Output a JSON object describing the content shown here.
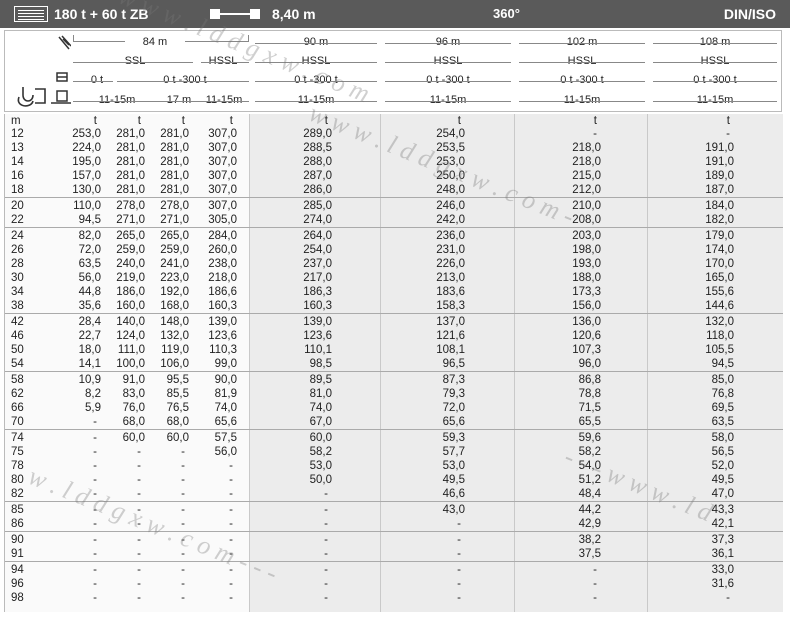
{
  "topbar": {
    "configuration": "180 t + 60 t ZB",
    "counterweight_radius": "8,40 m",
    "slew": "360°",
    "standard": "DIN/ISO"
  },
  "header": {
    "columns": [
      {
        "length": "84 m",
        "mode_a": "SSL",
        "mode_b": "HSSL",
        "ballast_a": "0 t",
        "ballast_b": "0 t -300 t",
        "angle_a": "11-15m",
        "angle_b": "17 m",
        "angle_c": "11-15m"
      },
      {
        "length": "90 m",
        "mode": "HSSL",
        "ballast": "0 t -300 t",
        "angle": "11-15m"
      },
      {
        "length": "96 m",
        "mode": "HSSL",
        "ballast": "0 t -300 t",
        "angle": "11-15m"
      },
      {
        "length": "102 m",
        "mode": "HSSL",
        "ballast": "0 t -300 t",
        "angle": "11-15m"
      },
      {
        "length": "108 m",
        "mode": "HSSL",
        "ballast": "0 t -300 t",
        "angle": "11-15m"
      }
    ]
  },
  "units": {
    "radius": "m",
    "load": "t"
  },
  "rows": [
    [
      "12",
      "253,0",
      "281,0",
      "281,0",
      "307,0",
      "289,0",
      "254,0",
      "-",
      "-"
    ],
    [
      "13",
      "224,0",
      "281,0",
      "281,0",
      "307,0",
      "288,5",
      "253,5",
      "218,0",
      "191,0"
    ],
    [
      "14",
      "195,0",
      "281,0",
      "281,0",
      "307,0",
      "288,0",
      "253,0",
      "218,0",
      "191,0"
    ],
    [
      "16",
      "157,0",
      "281,0",
      "281,0",
      "307,0",
      "287,0",
      "250,0",
      "215,0",
      "189,0"
    ],
    [
      "18",
      "130,0",
      "281,0",
      "281,0",
      "307,0",
      "286,0",
      "248,0",
      "212,0",
      "187,0"
    ],
    [
      "20",
      "110,0",
      "278,0",
      "278,0",
      "307,0",
      "285,0",
      "246,0",
      "210,0",
      "184,0"
    ],
    [
      "22",
      "94,5",
      "271,0",
      "271,0",
      "305,0",
      "274,0",
      "242,0",
      "208,0",
      "182,0"
    ],
    [
      "24",
      "82,0",
      "265,0",
      "265,0",
      "284,0",
      "264,0",
      "236,0",
      "203,0",
      "179,0"
    ],
    [
      "26",
      "72,0",
      "259,0",
      "259,0",
      "260,0",
      "254,0",
      "231,0",
      "198,0",
      "174,0"
    ],
    [
      "28",
      "63,5",
      "240,0",
      "241,0",
      "238,0",
      "237,0",
      "226,0",
      "193,0",
      "170,0"
    ],
    [
      "30",
      "56,0",
      "219,0",
      "223,0",
      "218,0",
      "217,0",
      "213,0",
      "188,0",
      "165,0"
    ],
    [
      "34",
      "44,8",
      "186,0",
      "192,0",
      "186,6",
      "186,3",
      "183,6",
      "173,3",
      "155,6"
    ],
    [
      "38",
      "35,6",
      "160,0",
      "168,0",
      "160,3",
      "160,3",
      "158,3",
      "156,0",
      "144,6"
    ],
    [
      "42",
      "28,4",
      "140,0",
      "148,0",
      "139,0",
      "139,0",
      "137,0",
      "136,0",
      "132,0"
    ],
    [
      "46",
      "22,7",
      "124,0",
      "132,0",
      "123,6",
      "123,6",
      "121,6",
      "120,6",
      "118,0"
    ],
    [
      "50",
      "18,0",
      "111,0",
      "119,0",
      "110,3",
      "110,1",
      "108,1",
      "107,3",
      "105,5"
    ],
    [
      "54",
      "14,1",
      "100,0",
      "106,0",
      "99,0",
      "98,5",
      "96,5",
      "96,0",
      "94,5"
    ],
    [
      "58",
      "10,9",
      "91,0",
      "95,5",
      "90,0",
      "89,5",
      "87,3",
      "86,8",
      "85,0"
    ],
    [
      "62",
      "8,2",
      "83,0",
      "85,5",
      "81,9",
      "81,0",
      "79,3",
      "78,8",
      "76,8"
    ],
    [
      "66",
      "5,9",
      "76,0",
      "76,5",
      "74,0",
      "74,0",
      "72,0",
      "71,5",
      "69,5"
    ],
    [
      "70",
      "-",
      "68,0",
      "68,0",
      "65,6",
      "67,0",
      "65,6",
      "65,5",
      "63,5"
    ],
    [
      "74",
      "-",
      "60,0",
      "60,0",
      "57,5",
      "60,0",
      "59,3",
      "59,6",
      "58,0"
    ],
    [
      "75",
      "-",
      "-",
      "-",
      "56,0",
      "58,2",
      "57,7",
      "58,2",
      "56,5"
    ],
    [
      "78",
      "-",
      "-",
      "-",
      "-",
      "53,0",
      "53,0",
      "54,0",
      "52,0"
    ],
    [
      "80",
      "-",
      "-",
      "-",
      "-",
      "50,0",
      "49,5",
      "51,2",
      "49,5"
    ],
    [
      "82",
      "-",
      "-",
      "-",
      "-",
      "-",
      "46,6",
      "48,4",
      "47,0"
    ],
    [
      "85",
      "-",
      "-",
      "-",
      "-",
      "-",
      "43,0",
      "44,2",
      "43,3"
    ],
    [
      "86",
      "-",
      "-",
      "-",
      "-",
      "-",
      "-",
      "42,9",
      "42,1"
    ],
    [
      "90",
      "-",
      "-",
      "-",
      "-",
      "-",
      "-",
      "38,2",
      "37,3"
    ],
    [
      "91",
      "-",
      "-",
      "-",
      "-",
      "-",
      "-",
      "37,5",
      "36,1"
    ],
    [
      "94",
      "-",
      "-",
      "-",
      "-",
      "-",
      "-",
      "-",
      "33,0"
    ],
    [
      "96",
      "-",
      "-",
      "-",
      "-",
      "-",
      "-",
      "-",
      "31,6"
    ],
    [
      "98",
      "-",
      "-",
      "-",
      "-",
      "-",
      "-",
      "-",
      "-"
    ]
  ],
  "watermarks": [
    "w w w . l d d g x w . c o m",
    "w w w . l d d g x w . c o m -",
    "- - - w w w . l d",
    "w . l d d g x w . c o m - - -"
  ]
}
